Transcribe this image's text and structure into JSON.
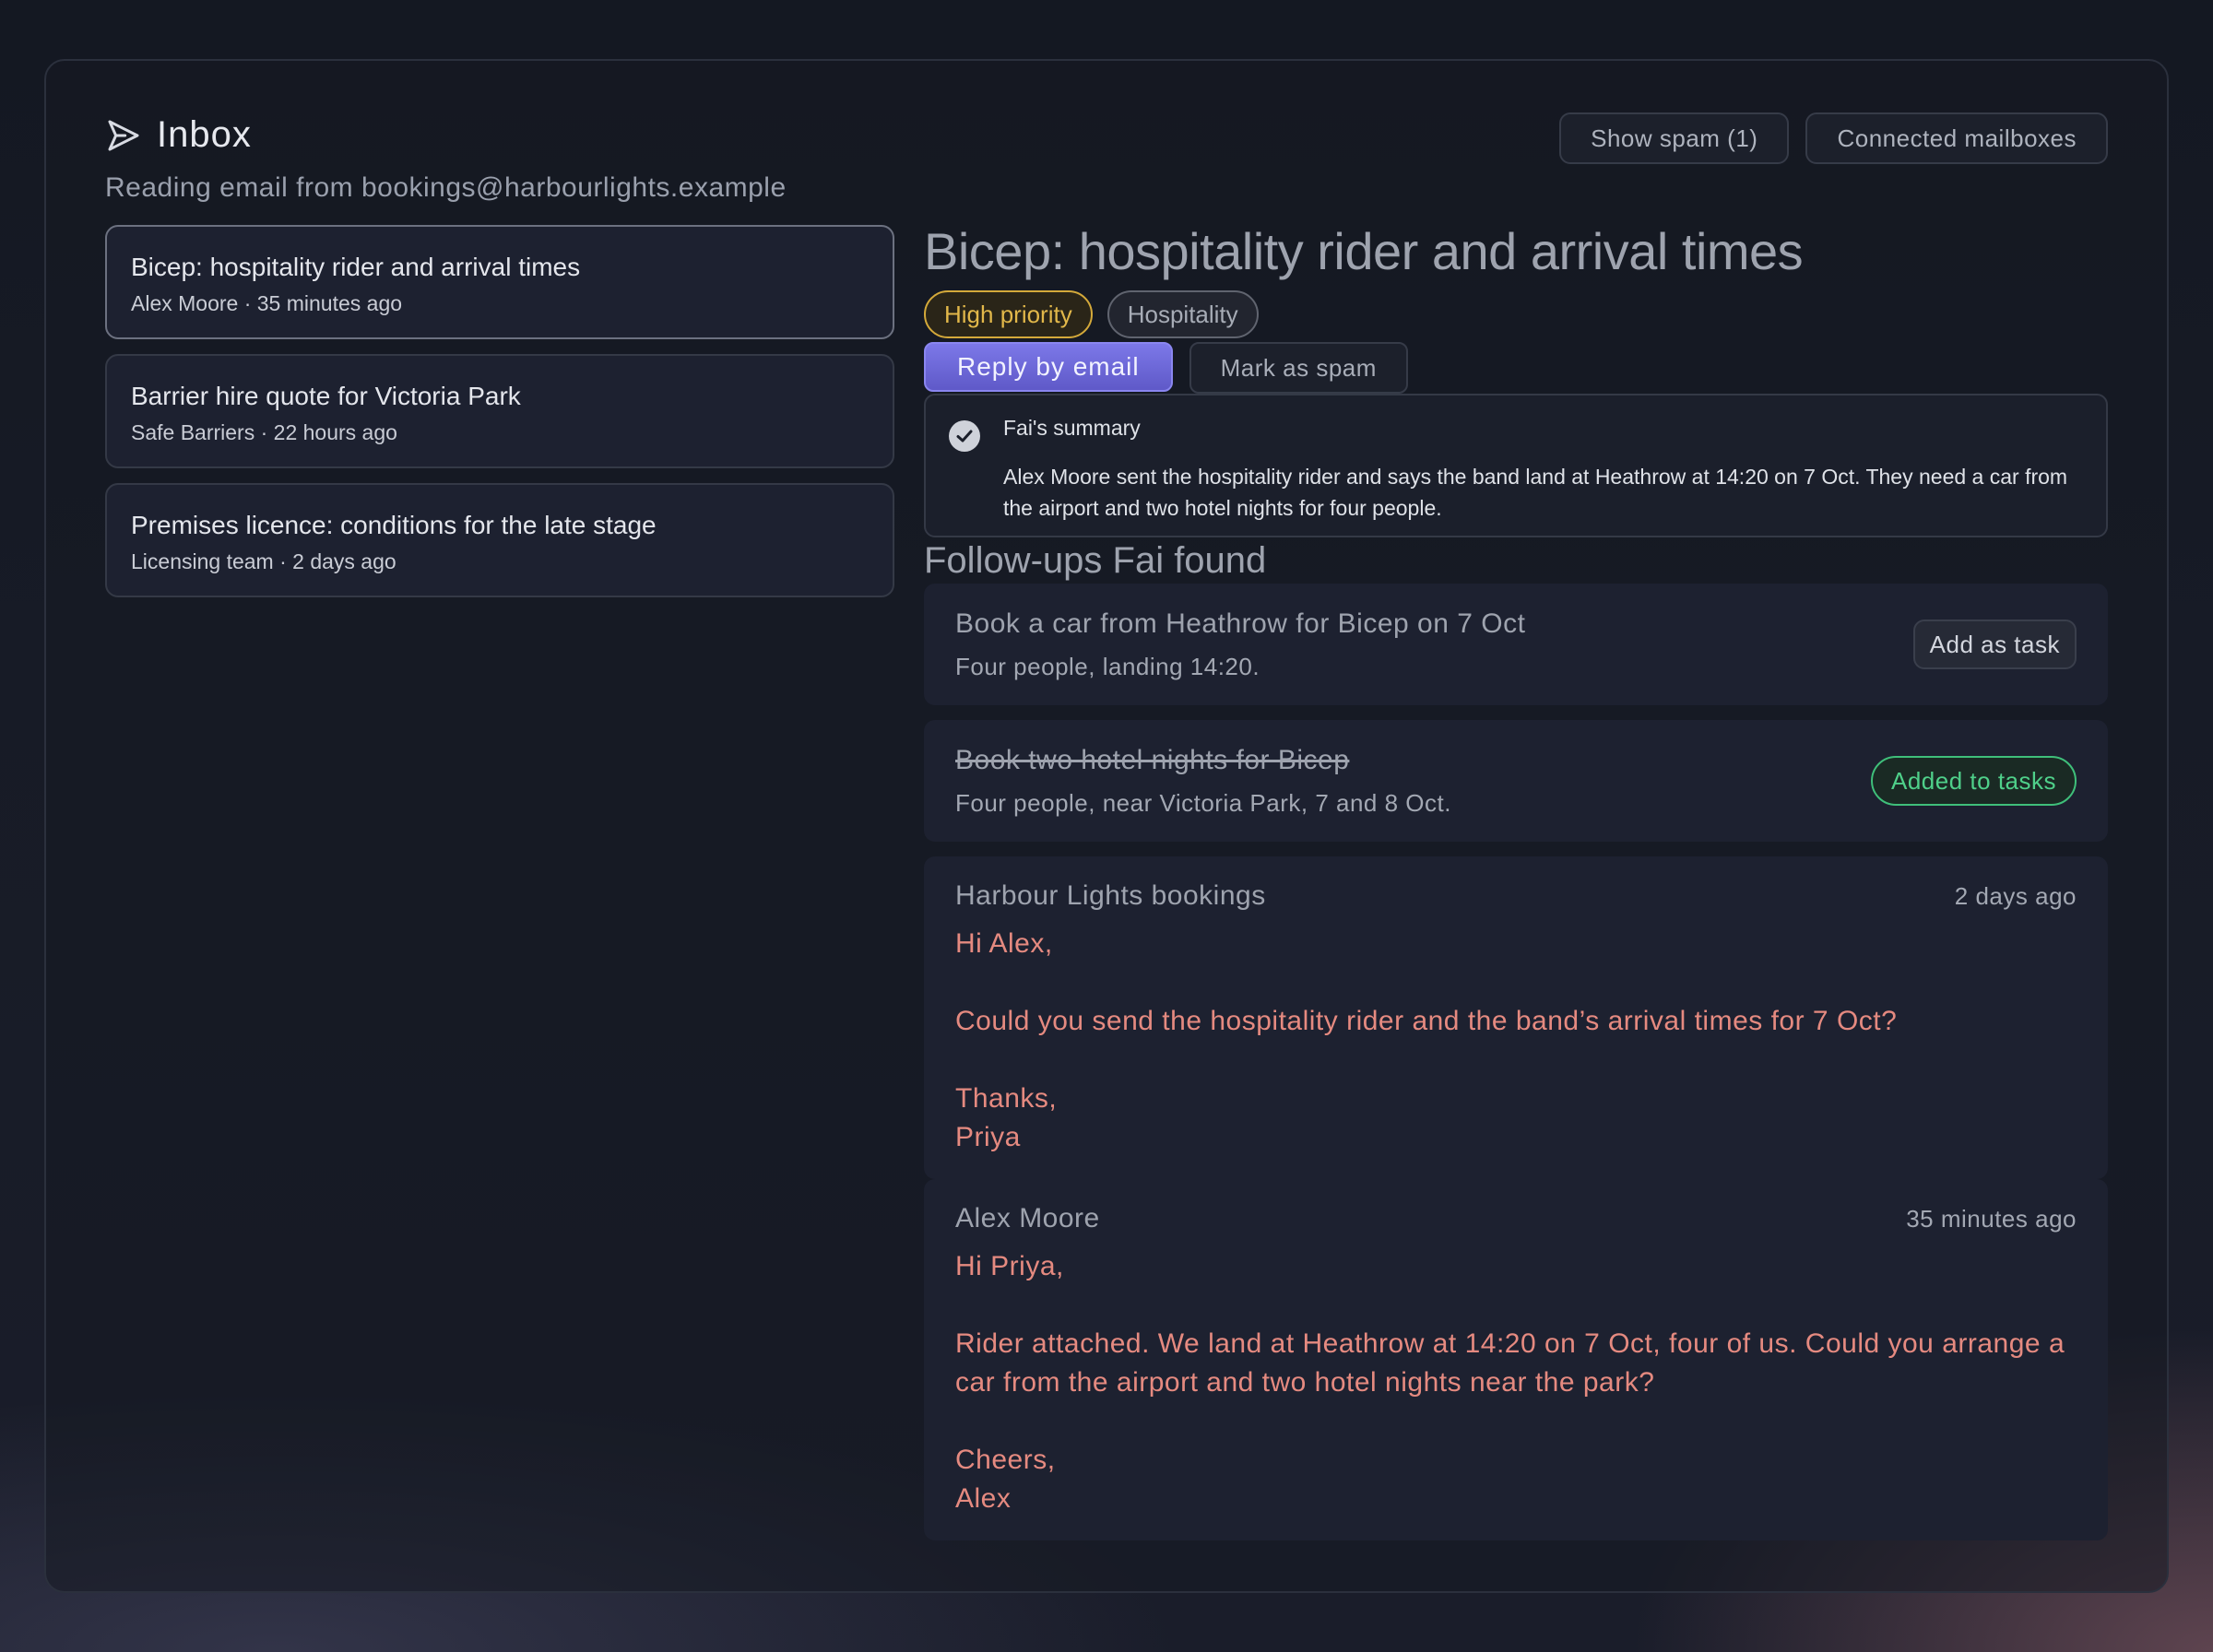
{
  "header": {
    "title": "Inbox",
    "subtitle": "Reading email from bookings@harbourlights.example"
  },
  "top_actions": {
    "show_spam": "Show spam (1)",
    "connected_mailboxes": "Connected mailboxes"
  },
  "threads": [
    {
      "subject": "Bicep: hospitality rider and arrival times",
      "meta": "Alex Moore · 35 minutes ago"
    },
    {
      "subject": "Barrier hire quote for Victoria Park",
      "meta": "Safe Barriers · 22 hours ago"
    },
    {
      "subject": "Premises licence: conditions for the late stage",
      "meta": "Licensing team · 2 days ago"
    }
  ],
  "detail": {
    "title": "Bicep: hospitality rider and arrival times",
    "tags": {
      "priority": "High priority",
      "category": "Hospitality"
    },
    "reply_label": "Reply by email",
    "spam_label": "Mark as spam",
    "summary": {
      "label": "Fai's summary",
      "text": "Alex Moore sent the hospitality rider and says the band land at Heathrow at 14:20 on 7 Oct. They need a car from the airport and two hotel nights for four people."
    },
    "followups_title": "Follow-ups Fai found",
    "followups": [
      {
        "title": "Book a car from Heathrow for Bicep on 7 Oct",
        "desc": "Four people, landing 14:20.",
        "action": "Add as task"
      },
      {
        "title": "Book two hotel nights for Bicep",
        "desc": "Four people, near Victoria Park, 7 and 8 Oct.",
        "action": "Added to tasks"
      }
    ],
    "messages": [
      {
        "from": "Harbour Lights bookings",
        "time": "2 days ago",
        "body": "Hi Alex,\n\nCould you send the hospitality rider and the band’s arrival times for 7 Oct?\n\nThanks,\nPriya"
      },
      {
        "from": "Alex Moore",
        "time": "35 minutes ago",
        "body": "Hi Priya,\n\nRider attached. We land at Heathrow at 14:20 on 7 Oct, four of us. Could you arrange a car from the airport and two hotel nights near the park?\n\nCheers,\nAlex"
      }
    ]
  },
  "colors": {
    "accent": "#6c68e0",
    "priority": "#e2b84a",
    "success": "#4fd08a",
    "message_text": "#e58a80"
  },
  "icons": {
    "inbox": "send-icon",
    "summary": "check-circle-icon"
  }
}
